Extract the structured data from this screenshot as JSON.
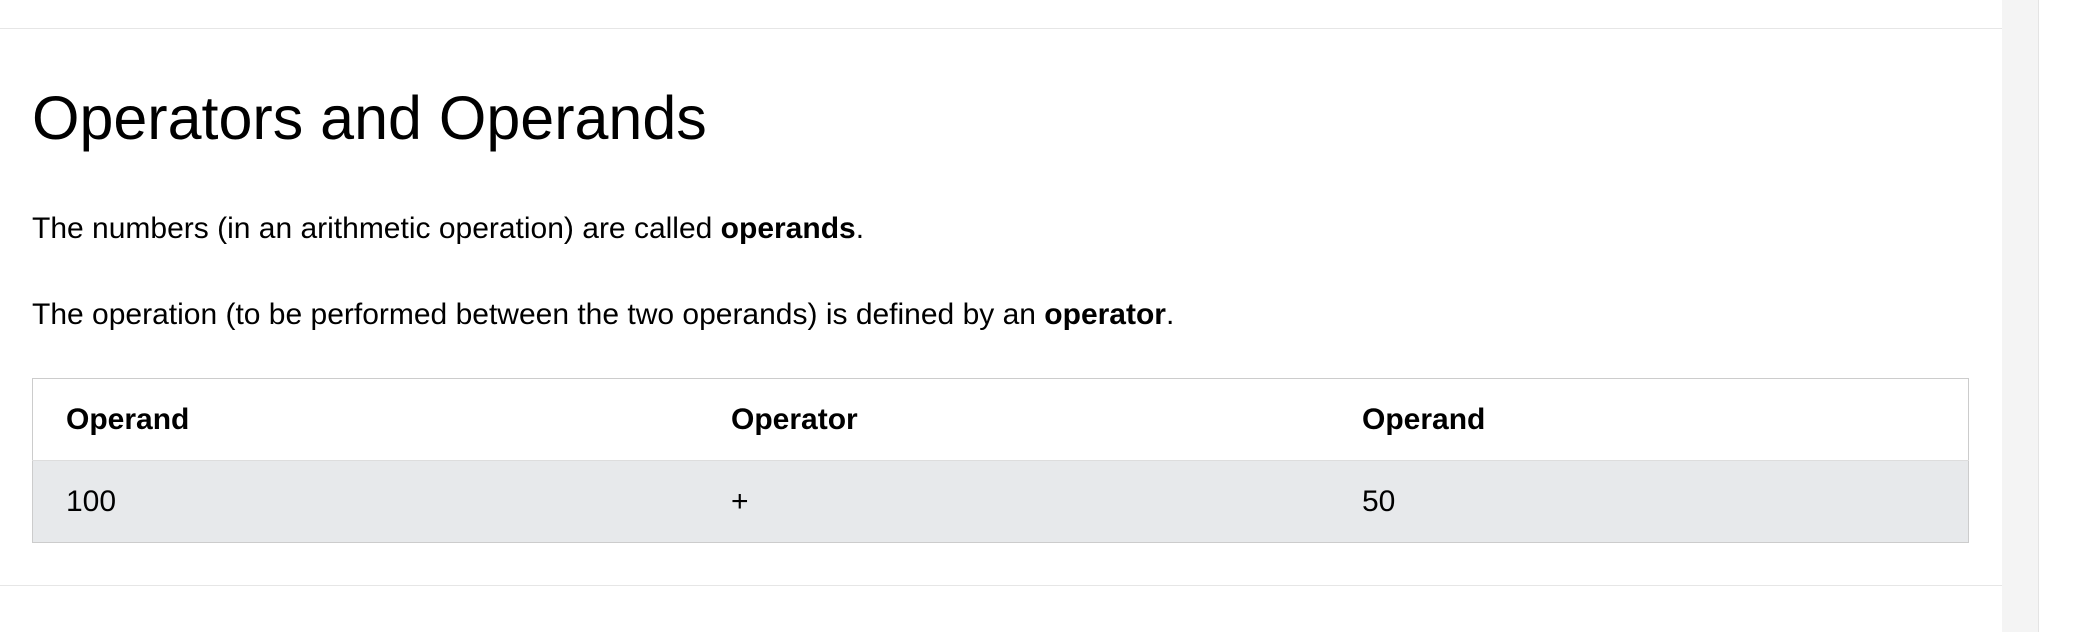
{
  "section": {
    "title": "Operators and Operands",
    "para1": {
      "before": "The numbers (in an arithmetic operation) are called ",
      "bold": "operands",
      "after": "."
    },
    "para2": {
      "before": "The operation (to be performed between the two operands) is defined by an ",
      "bold": "operator",
      "after": "."
    }
  },
  "table": {
    "headers": [
      "Operand",
      "Operator",
      "Operand"
    ],
    "rows": [
      [
        "100",
        "+",
        "50"
      ]
    ]
  },
  "colors": {
    "row_background": "#e7e9eb",
    "table_border": "#cccccc",
    "divider": "#e6e6e6"
  }
}
